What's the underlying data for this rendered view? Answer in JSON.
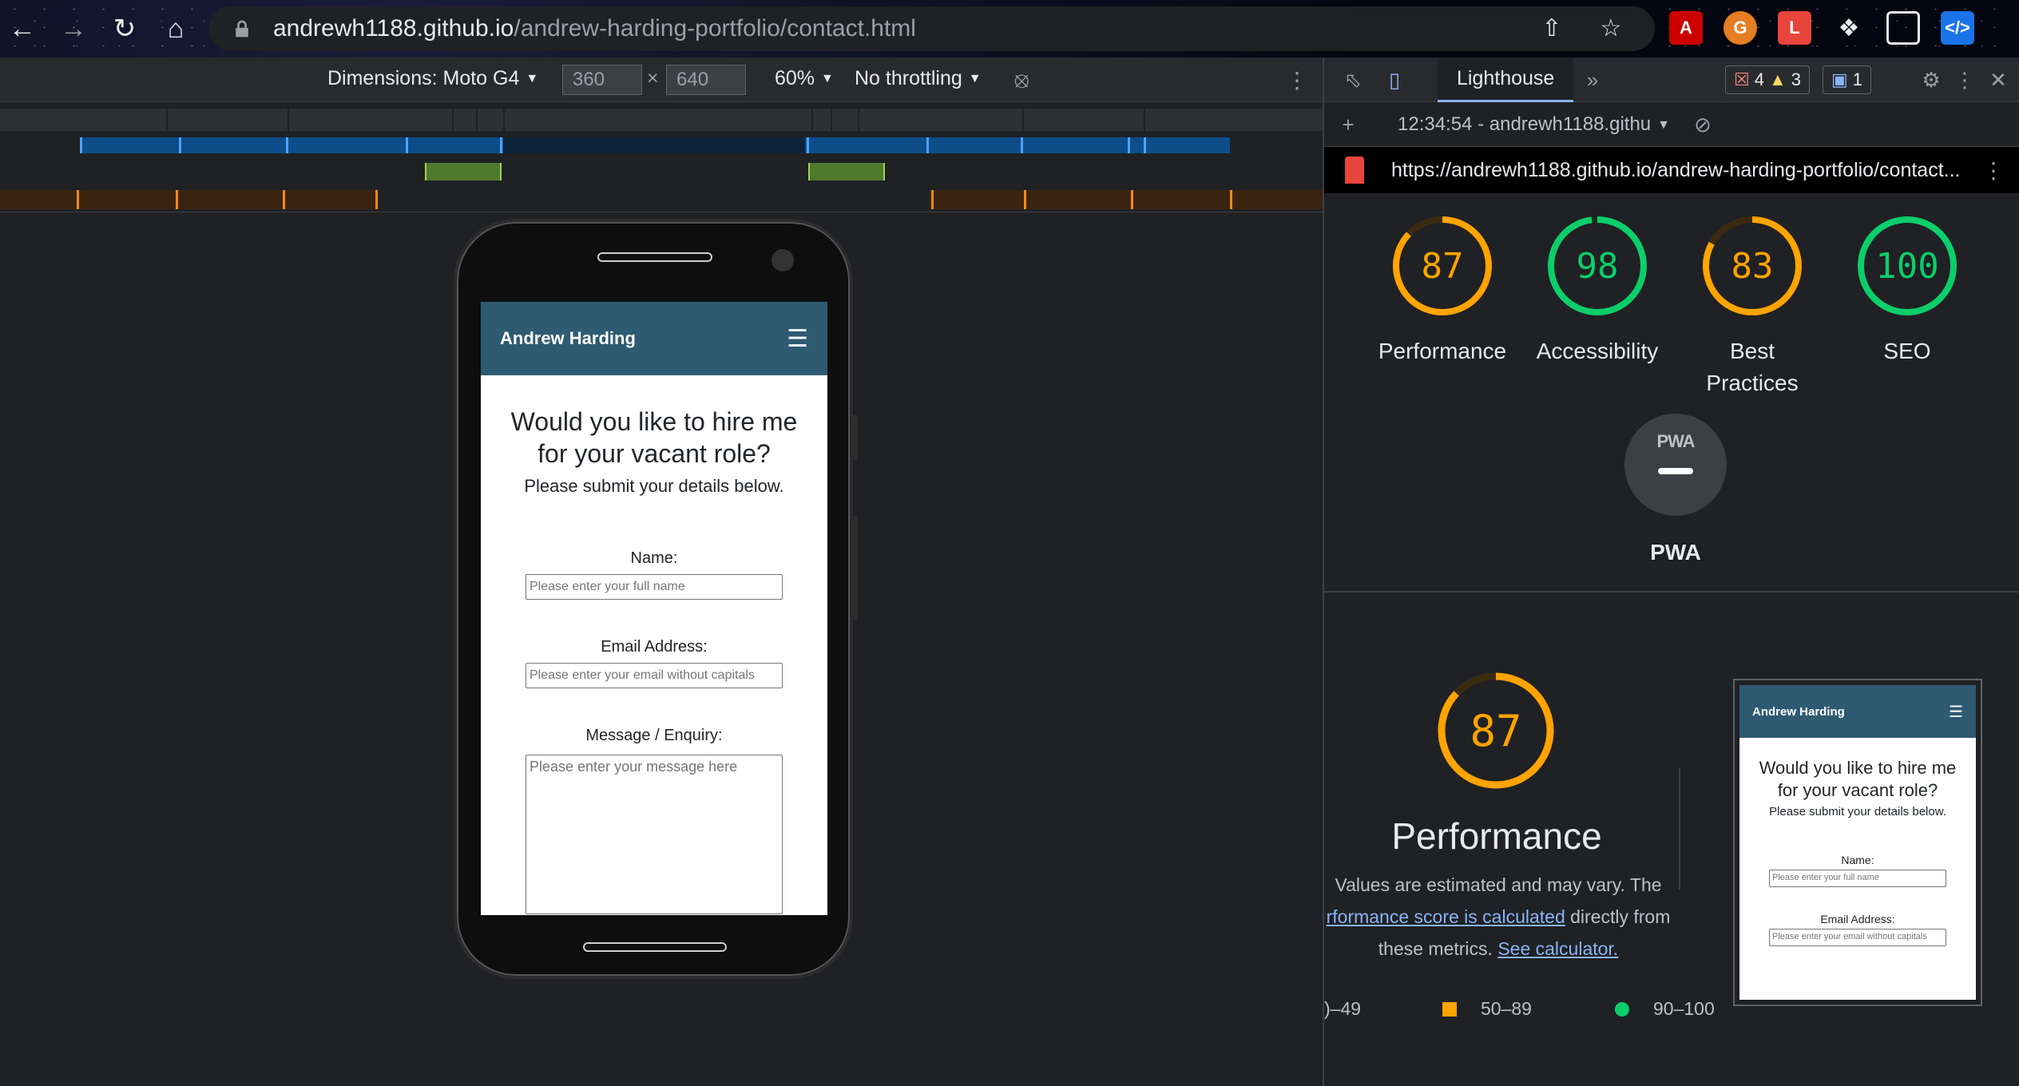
{
  "browser": {
    "url_host": "andrewh1188.github.io",
    "url_path": "/andrew-harding-portfolio/contact.html"
  },
  "device_toolbar": {
    "dimensions_label": "Dimensions: Moto G4",
    "width": "360",
    "times": "×",
    "height": "640",
    "zoom": "60%",
    "throttling": "No throttling"
  },
  "site": {
    "brand": "Andrew Harding",
    "heading": "Would you like to hire me for your vacant role?",
    "subheading": "Please submit your details below.",
    "name_label": "Name:",
    "name_placeholder": "Please enter your full name",
    "email_label": "Email Address:",
    "email_placeholder": "Please enter your email without capitals",
    "message_label": "Message / Enquiry:",
    "message_placeholder": "Please enter your message here"
  },
  "devtools": {
    "active_tab": "Lighthouse",
    "errors": "4",
    "warnings": "3",
    "messages": "1",
    "report_time": "12:34:54 - andrewh1188.githu",
    "report_url": "https://andrewh1188.github.io/andrew-harding-portfolio/contact..."
  },
  "lighthouse": {
    "categories": [
      {
        "label": "Performance",
        "score": "87",
        "value": 87,
        "color": "#ffa400",
        "bg": "#3a2a10"
      },
      {
        "label": "Accessibility",
        "score": "98",
        "value": 98,
        "color": "#0cce6b",
        "bg": "#0f2e1c"
      },
      {
        "label": "Best Practices",
        "score": "83",
        "value": 83,
        "color": "#ffa400",
        "bg": "#3a2a10"
      },
      {
        "label": "SEO",
        "score": "100",
        "value": 100,
        "color": "#0cce6b",
        "bg": "#0f2e1c"
      }
    ],
    "pwa": {
      "label": "PWA",
      "badge": "PWA"
    },
    "performance": {
      "score": "87",
      "value": 87,
      "title": "Performance",
      "desc_line1": "Values are estimated and may vary. The",
      "desc_link1": "rformance score is calculated",
      "desc_line2_rest": " directly from",
      "desc_line3": "these metrics. ",
      "desc_link2": "See calculator.",
      "legend_poor": ")–49",
      "legend_avg": "50–89",
      "legend_good": "90–100"
    }
  },
  "colors": {
    "accent_orange": "#ffa400",
    "accent_green": "#0cce6b",
    "site_nav": "#2e5a72",
    "link_blue": "#8ab4f8"
  }
}
